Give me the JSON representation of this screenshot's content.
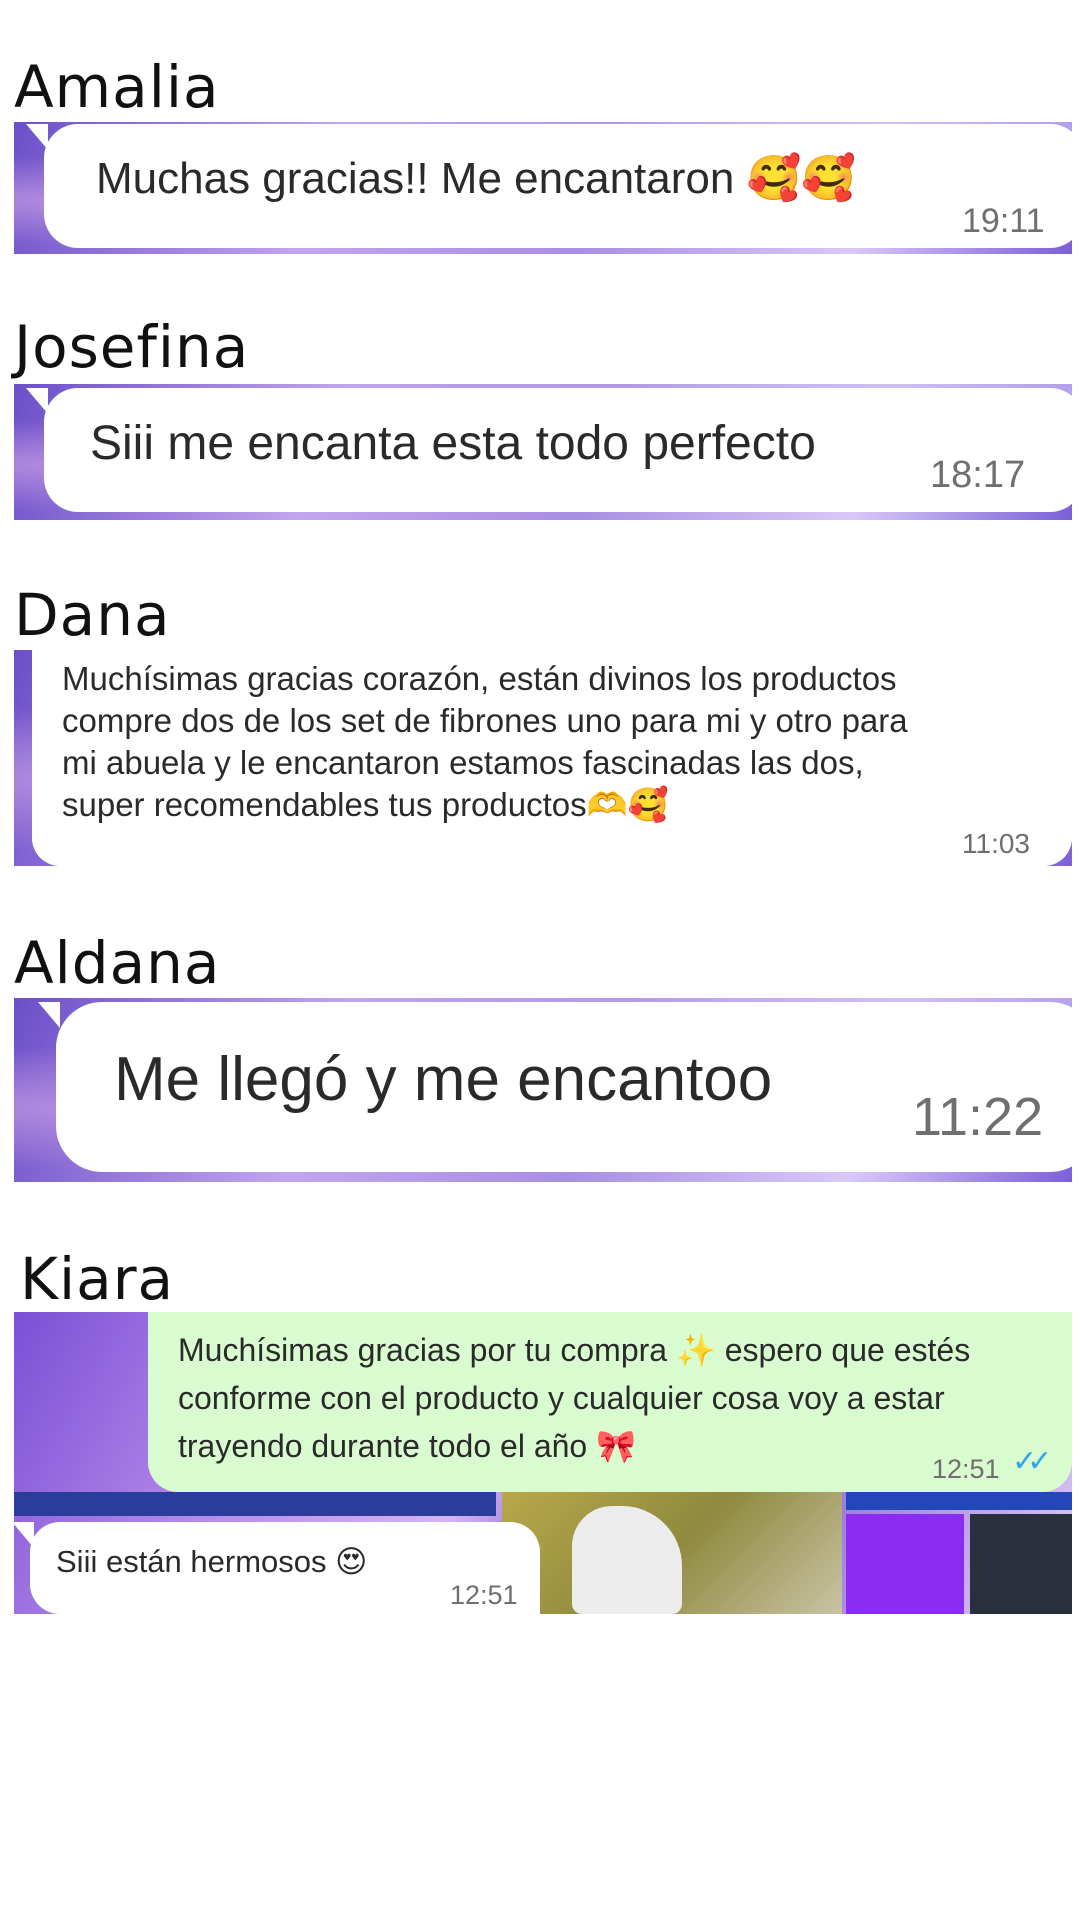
{
  "reviews": [
    {
      "name": "Amalia",
      "message": "Muchas gracias!! Me encantaron",
      "emoji": "🥰🥰",
      "time": "19:11"
    },
    {
      "name": "Josefina",
      "message": "Siii me encanta esta todo perfecto",
      "time": "18:17"
    },
    {
      "name": "Dana",
      "message_lines": [
        "Muchísimas gracias corazón, están divinos los productos",
        "compre dos de los set de fibrones uno para mi y otro para",
        "mi abuela y le encantaron estamos fascinadas las dos,",
        "super recomendables tus productos"
      ],
      "emoji": "🫶🥰",
      "time": "11:03"
    },
    {
      "name": "Aldana",
      "message": "Me llegó y me encantoo",
      "time": "11:22"
    },
    {
      "name": "Kiara",
      "sent_message_lines": [
        "Muchísimas gracias por tu compra",
        "conforme con el producto y cualquier cosa voy a estar",
        "trayendo durante todo el año"
      ],
      "sent_inline_emoji": "✨",
      "sent_line1_tail": "espero que estés",
      "sent_end_emoji": "🎀",
      "sent_time": "12:51",
      "sent_status_icon": "double-check-read",
      "reply_message": "Siii están hermosos",
      "reply_emoji": "😍",
      "reply_time": "12:51"
    }
  ],
  "colors": {
    "incoming_bubble": "#ffffff",
    "outgoing_bubble": "#d9fbd0",
    "read_check": "#35a4e8",
    "wallpaper_purple": "#a88ee2"
  }
}
